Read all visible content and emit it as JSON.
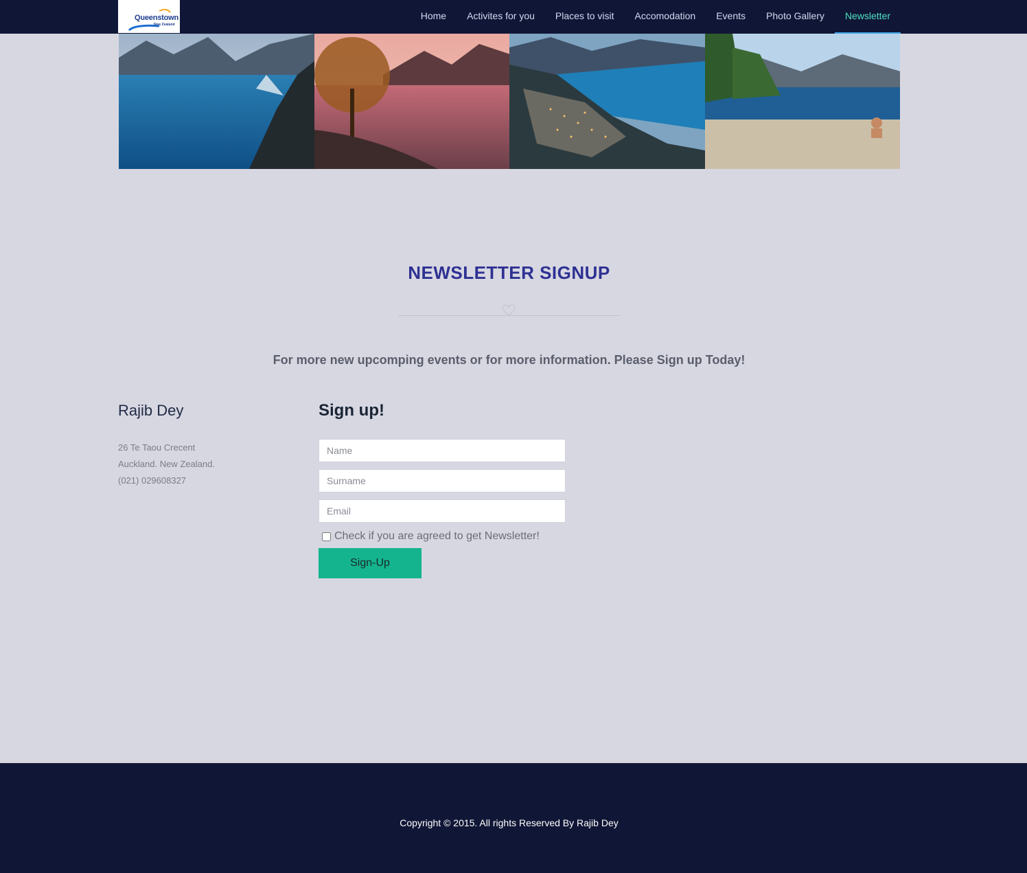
{
  "brand": {
    "logo_text": "Queenstown",
    "logo_subtext": "New Zealand"
  },
  "nav": {
    "items": [
      {
        "label": "Home"
      },
      {
        "label": "Activites for you"
      },
      {
        "label": "Places to visit"
      },
      {
        "label": "Accomodation"
      },
      {
        "label": "Events"
      },
      {
        "label": "Photo Gallery"
      },
      {
        "label": "Newsletter",
        "active": true
      }
    ]
  },
  "banner": {
    "images": [
      {
        "subject": "lake between mountains"
      },
      {
        "subject": "willow tree at pink sunset lake"
      },
      {
        "subject": "aerial view of lakeside town at dusk"
      },
      {
        "subject": "beach with people by lake"
      }
    ]
  },
  "main": {
    "title": "NEWSLETTER SIGNUP",
    "divider_icon": "heart-icon",
    "intro": "For more new upcomping events or for more information. Please Sign up Today!"
  },
  "contact": {
    "name": "Rajib Dey",
    "address_line1": "26 Te Taou Crecent",
    "address_line2": "Auckland. New Zealand.",
    "phone": "(021) 029608327"
  },
  "form": {
    "title": "Sign up!",
    "name_placeholder": "Name",
    "name_value": "",
    "surname_placeholder": "Surname",
    "surname_value": "",
    "email_placeholder": "Email",
    "email_value": "",
    "checkbox_label": "Check if you are agreed to get Newsletter!",
    "checkbox_checked": false,
    "submit_label": "Sign-Up"
  },
  "footer": {
    "copyright": "Copyright © 2015. All rights Reserved By Rajib Dey"
  },
  "colors": {
    "nav_bg": "#101636",
    "page_bg": "#d7d7e2",
    "accent": "#14b48e",
    "active_nav": "#4fe0c0",
    "title": "#2e3192"
  }
}
